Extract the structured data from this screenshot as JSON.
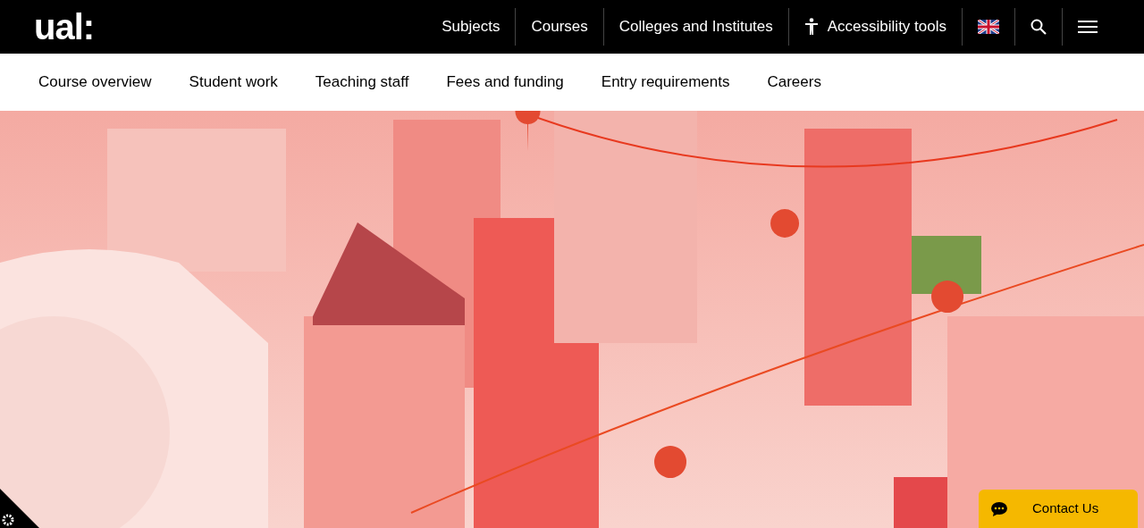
{
  "header": {
    "logo": "ual:",
    "nav": [
      {
        "label": "Subjects",
        "kind": "link"
      },
      {
        "label": "Courses",
        "kind": "link"
      },
      {
        "label": "Colleges and Institutes",
        "kind": "link"
      },
      {
        "label": "Accessibility tools",
        "kind": "accessibility"
      },
      {
        "kind": "flag"
      },
      {
        "kind": "search"
      },
      {
        "kind": "menu"
      }
    ]
  },
  "course_nav": [
    {
      "label": "Course overview"
    },
    {
      "label": "Student work"
    },
    {
      "label": "Teaching staff"
    },
    {
      "label": "Fees and funding"
    },
    {
      "label": "Entry requirements"
    },
    {
      "label": "Careers"
    }
  ],
  "contact_button": {
    "label": "Contact Us"
  }
}
